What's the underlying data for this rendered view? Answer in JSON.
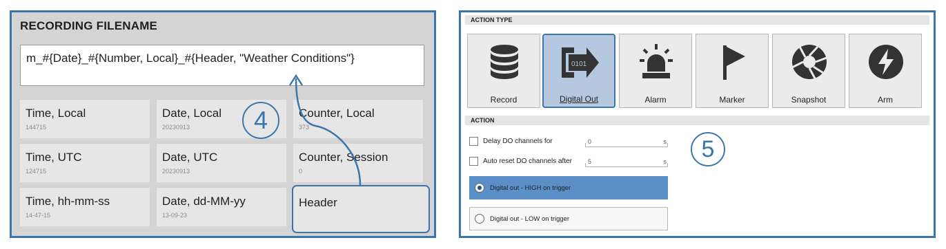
{
  "recording": {
    "title": "RECORDING FILENAME",
    "filename": "m_#{Date}_#{Number, Local}_#{Header, \"Weather Conditions\"}",
    "tiles": [
      {
        "label": "Time, Local",
        "sub": "144715"
      },
      {
        "label": "Date, Local",
        "sub": "20230913"
      },
      {
        "label": "Counter, Local",
        "sub": "373"
      },
      {
        "label": "Time, UTC",
        "sub": "124715"
      },
      {
        "label": "Date, UTC",
        "sub": "20230913"
      },
      {
        "label": "Counter, Session",
        "sub": "0"
      },
      {
        "label": "Time, hh-mm-ss",
        "sub": "14-47-15"
      },
      {
        "label": "Date, dd-MM-yy",
        "sub": "13-09-23"
      },
      {
        "label": "Header",
        "sub": ""
      }
    ],
    "callout": "4"
  },
  "action_type": {
    "title": "ACTION TYPE",
    "buttons": [
      {
        "label": "Record",
        "icon": "database-icon",
        "selected": false
      },
      {
        "label": "Digital Out",
        "icon": "digital-out-icon",
        "selected": true,
        "icon_text": "0101"
      },
      {
        "label": "Alarm",
        "icon": "siren-icon",
        "selected": false
      },
      {
        "label": "Marker",
        "icon": "flag-icon",
        "selected": false
      },
      {
        "label": "Snapshot",
        "icon": "camera-shutter-icon",
        "selected": false
      },
      {
        "label": "Arm",
        "icon": "lightning-icon",
        "selected": false
      }
    ]
  },
  "action": {
    "title": "ACTION",
    "delay": {
      "label": "Delay DO channels for",
      "value": "0",
      "unit": "s"
    },
    "auto_reset": {
      "label": "Auto reset DO channels after",
      "value": "5",
      "unit": "s"
    },
    "radio_high": "Digital out - HIGH on trigger",
    "radio_low": "Digital out - LOW on trigger",
    "callout": "5"
  },
  "colors": {
    "accent": "#3a76ad",
    "selected_fill": "#b5c8e0",
    "radio_active": "#5b8fc7",
    "panel_gray": "#d4d4d4"
  }
}
